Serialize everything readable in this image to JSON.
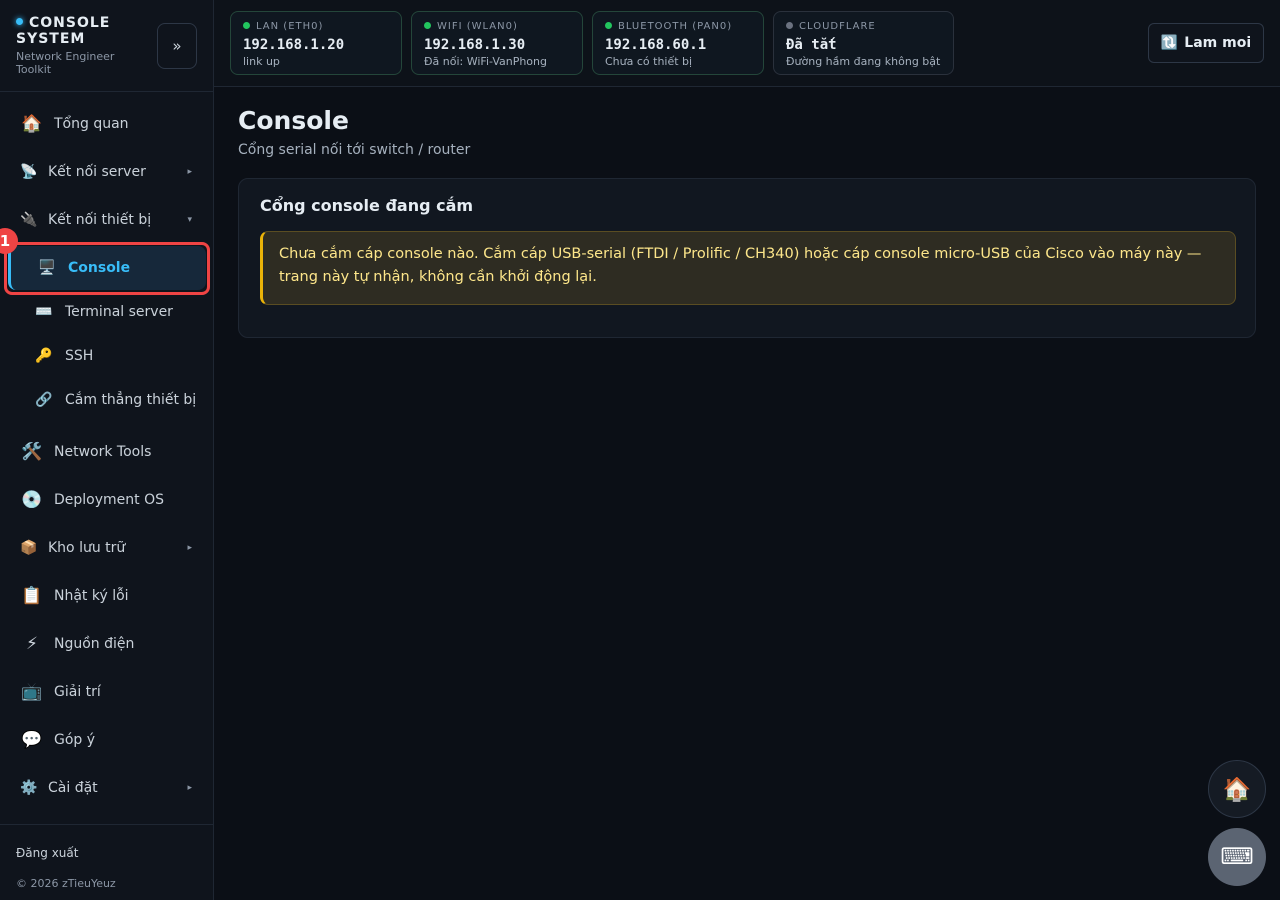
{
  "brand": {
    "title": "CONSOLE SYSTEM",
    "subtitle": "Network Engineer Toolkit",
    "collapse_label": "»"
  },
  "nav": {
    "items": [
      {
        "label": "Tổng quan",
        "icon": "🏠"
      },
      {
        "label": "Kết nối server",
        "icon": "📡",
        "chevron": "▸"
      },
      {
        "label": "Kết nối thiết bị",
        "icon": "🔌",
        "chevron": "▾"
      },
      {
        "label": "Network Tools",
        "icon": "🛠️"
      },
      {
        "label": "Deployment OS",
        "icon": "💿"
      },
      {
        "label": "Kho lưu trữ",
        "icon": "📦",
        "chevron": "▸"
      },
      {
        "label": "Nhật ký lỗi",
        "icon": "📋"
      },
      {
        "label": "Nguồn điện",
        "icon": "⚡"
      },
      {
        "label": "Giải trí",
        "icon": "📺"
      },
      {
        "label": "Góp ý",
        "icon": "💬"
      },
      {
        "label": "Cài đặt",
        "icon": "⚙️",
        "chevron": "▸"
      }
    ],
    "sub_items": [
      {
        "label": "Console",
        "icon": "🖥️"
      },
      {
        "label": "Terminal server",
        "icon": "⌨️"
      },
      {
        "label": "SSH",
        "icon": "🔑"
      },
      {
        "label": "Cắm thẳng thiết bị",
        "icon": "🔗"
      }
    ],
    "annotation_badge": "1"
  },
  "footer": {
    "logout": "Đăng xuất",
    "copyright": "© 2026 zTieuYeuz"
  },
  "status": [
    {
      "label": "LAN (ETH0)",
      "value": "192.168.1.20",
      "sub": "link up",
      "color": "#22c55e"
    },
    {
      "label": "WIFI (WLAN0)",
      "value": "192.168.1.30",
      "sub": "Đã nối: WiFi-VanPhong",
      "color": "#22c55e"
    },
    {
      "label": "BLUETOOTH (PAN0)",
      "value": "192.168.60.1",
      "sub": "Chưa có thiết bị",
      "color": "#22c55e"
    },
    {
      "label": "CLOUDFLARE",
      "value": "Đã tắt",
      "sub": "Đường hầm đang không bật",
      "color": "#6b7280"
    }
  ],
  "toolbar": {
    "refresh_icon": "🔃",
    "refresh_label": "Lam moi"
  },
  "page": {
    "title": "Console",
    "subtitle": "Cổng serial nối tới switch / router"
  },
  "panel": {
    "title": "Cổng console đang cắm",
    "warning": "Chưa cắm cáp console nào. Cắm cáp USB-serial (FTDI / Prolific / CH340) hoặc cáp console micro-USB của Cisco vào máy này — trang này tự nhận, không cần khởi động lại."
  },
  "fab": {
    "home_icon": "🏠",
    "keyboard_icon": "⌨"
  },
  "colors": {
    "accent": "#38bdf8",
    "highlight": "#ef4444",
    "warning": "#eab308"
  }
}
